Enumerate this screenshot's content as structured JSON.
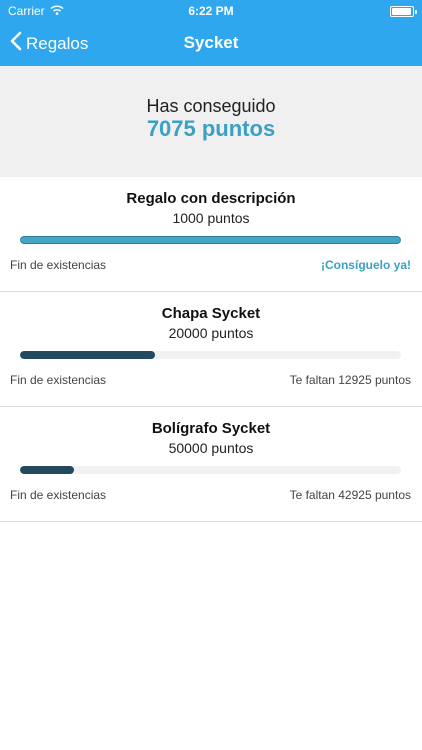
{
  "status": {
    "carrier": "Carrier",
    "time": "6:22 PM"
  },
  "nav": {
    "back_label": "Regalos",
    "title": "Sycket"
  },
  "summary": {
    "label": "Has conseguido",
    "points": "7075 puntos"
  },
  "accent_color": "#2fa7ee",
  "gifts": [
    {
      "title": "Regalo con descripción",
      "points": "1000 puntos",
      "progress": 1.0,
      "stock": "Fin de existencias",
      "action": "¡Consíguelo ya!"
    },
    {
      "title": "Chapa Sycket",
      "points": "20000 puntos",
      "progress": 0.354,
      "stock": "Fin de existencias",
      "action": "Te faltan 12925 puntos"
    },
    {
      "title": "Bolígrafo Sycket",
      "points": "50000 puntos",
      "progress": 0.142,
      "stock": "Fin de existencias",
      "action": "Te faltan 42925 puntos"
    }
  ]
}
